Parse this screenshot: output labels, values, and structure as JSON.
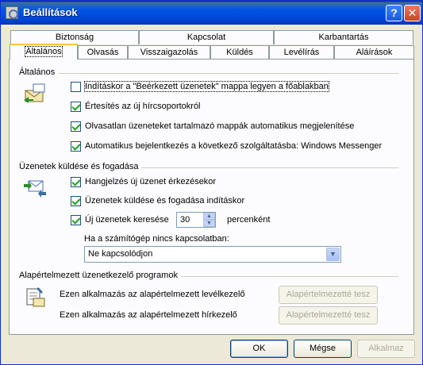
{
  "window": {
    "title": "Beállítások"
  },
  "titlebar": {
    "help_label": "?",
    "close_label": "✕"
  },
  "tabs": {
    "row1": [
      "Biztonság",
      "Kapcsolat",
      "Karbantartás"
    ],
    "row2": [
      "Általános",
      "Olvasás",
      "Visszaigazolás",
      "Küldés",
      "Levélírás",
      "Aláírások"
    ],
    "active": "Általános"
  },
  "general": {
    "title": "Általános",
    "icon": "mail-envelope-icon",
    "options": [
      {
        "label": "Indításkor a \"Beérkezett üzenetek\" mappa legyen a főablakban",
        "checked": false
      },
      {
        "label": "Értesítés az új hírcsoportokról",
        "checked": true
      },
      {
        "label": "Olvasatlan üzeneteket tartalmazó mappák automatikus megjelenítése",
        "checked": true
      },
      {
        "label": "Automatikus bejelentkezés a következő szolgáltatásba: Windows Messenger",
        "checked": true
      }
    ]
  },
  "sendreceive": {
    "title": "Üzenetek küldése és fogadása",
    "icon": "send-receive-icon",
    "options": [
      {
        "label": "Hangjelzés új üzenet érkezésekor",
        "checked": true
      },
      {
        "label": "Üzenetek küldése és fogadása indításkor",
        "checked": true
      },
      {
        "label": "Új üzenetek keresése",
        "checked": true
      }
    ],
    "interval_value": "30",
    "interval_unit": "percenként",
    "offline_label": "Ha a számítógép nincs kapcsolatban:",
    "offline_value": "Ne kapcsolódjon"
  },
  "defaults": {
    "title": "Alapértelmezett üzenetkezelő programok",
    "icon": "mail-program-icon",
    "mail_text": "Ezen alkalmazás az alapértelmezett levélkezelő",
    "news_text": "Ezen alkalmazás az alapértelmezett hírkezelő",
    "set_default_label": "Alapértelmezetté tesz"
  },
  "buttons": {
    "ok": "OK",
    "cancel": "Mégse",
    "apply": "Alkalmaz"
  },
  "colors": {
    "title_bar": "#0055e5",
    "check": "#21a121",
    "active_tab_accent": "#ffc83c"
  }
}
